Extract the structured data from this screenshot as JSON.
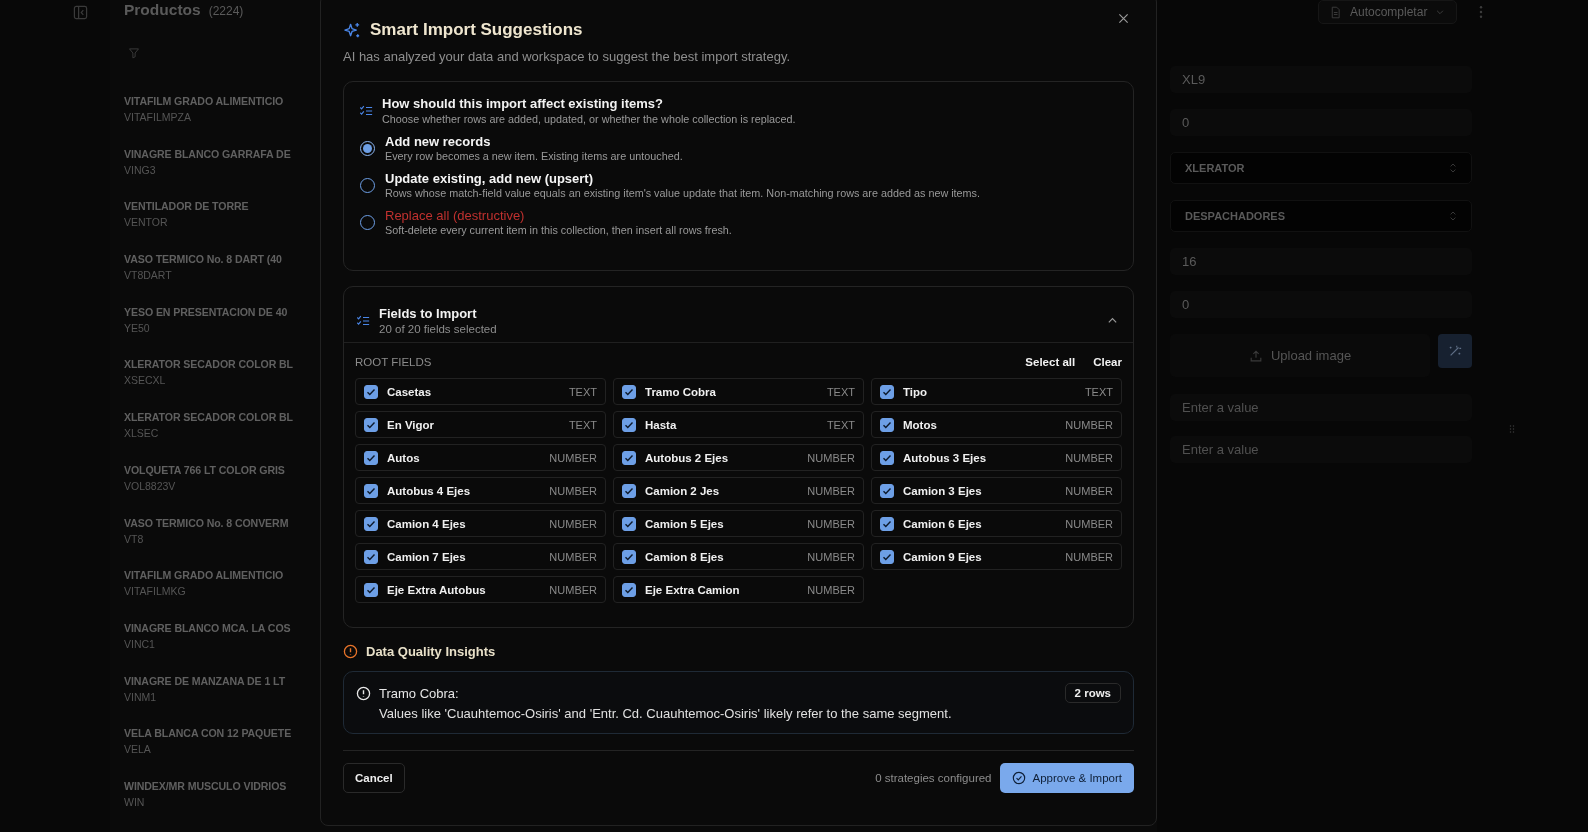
{
  "list": {
    "title": "Productos",
    "count": "(2224)",
    "items": [
      {
        "name": "VITAFILM GRADO ALIMENTICIO",
        "code": "VITAFILMPZA"
      },
      {
        "name": "VINAGRE BLANCO GARRAFA DE",
        "code": "VING3"
      },
      {
        "name": "VENTILADOR DE TORRE",
        "code": "VENTOR"
      },
      {
        "name": "VASO TERMICO No. 8 DART (40",
        "code": "VT8DART"
      },
      {
        "name": "YESO EN PRESENTACION DE 40",
        "code": "YE50"
      },
      {
        "name": "XLERATOR SECADOR COLOR BL",
        "code": "XSECXL"
      },
      {
        "name": "XLERATOR SECADOR COLOR BL",
        "code": "XLSEC"
      },
      {
        "name": "VOLQUETA 766 LT COLOR GRIS",
        "code": "VOL8823V"
      },
      {
        "name": "VASO TERMICO No. 8 CONVERM",
        "code": "VT8"
      },
      {
        "name": "VITAFILM GRADO ALIMENTICIO",
        "code": "VITAFILMKG"
      },
      {
        "name": "VINAGRE BLANCO MCA. LA COS",
        "code": "VINC1"
      },
      {
        "name": "VINAGRE DE MANZANA DE 1 LT",
        "code": "VINM1"
      },
      {
        "name": "VELA BLANCA CON 12 PAQUETE",
        "code": "VELA"
      },
      {
        "name": "WINDEX/MR MUSCULO VIDRIOS",
        "code": "WIN"
      }
    ]
  },
  "toolbar": {
    "autocomplete": "Autocompletar"
  },
  "form": {
    "fields": [
      {
        "kind": "input",
        "value": "XL9"
      },
      {
        "kind": "input",
        "value": "0"
      },
      {
        "kind": "select",
        "value": "XLERATOR"
      },
      {
        "kind": "select",
        "value": "DESPACHADORES"
      },
      {
        "kind": "input",
        "value": "16"
      },
      {
        "kind": "input",
        "value": "0"
      },
      {
        "kind": "upload",
        "label": "Upload image"
      },
      {
        "kind": "input",
        "placeholder": "Enter a value"
      },
      {
        "kind": "input",
        "placeholder": "Enter a value"
      }
    ]
  },
  "dialog": {
    "title": "Smart Import Suggestions",
    "subtitle": "AI has analyzed your data and workspace to suggest the best import strategy.",
    "mode": {
      "title": "How should this import affect existing items?",
      "hint": "Choose whether rows are added, updated, or whether the whole collection is replaced.",
      "options": [
        {
          "label": "Add new records",
          "description": "Every row becomes a new item. Existing items are untouched.",
          "selected": true,
          "kind": "normal"
        },
        {
          "label": "Update existing, add new (upsert)",
          "description": "Rows whose match-field value equals an existing item's value update that item. Non-matching rows are added as new items.",
          "selected": false,
          "kind": "normal"
        },
        {
          "label": "Replace all (destructive)",
          "description": "Soft-delete every current item in this collection, then insert all rows fresh.",
          "selected": false,
          "kind": "destructive"
        }
      ]
    },
    "fields": {
      "title": "Fields to Import",
      "count": "20 of 20 fields selected",
      "expanded": true,
      "group": "ROOT FIELDS",
      "select_all": "Select all",
      "clear": "Clear",
      "items": [
        {
          "name": "Casetas",
          "type": "TEXT",
          "checked": true
        },
        {
          "name": "Tramo Cobra",
          "type": "TEXT",
          "checked": true
        },
        {
          "name": "Tipo",
          "type": "TEXT",
          "checked": true
        },
        {
          "name": "En Vigor",
          "type": "TEXT",
          "checked": true
        },
        {
          "name": "Hasta",
          "type": "TEXT",
          "checked": true
        },
        {
          "name": "Motos",
          "type": "NUMBER",
          "checked": true
        },
        {
          "name": "Autos",
          "type": "NUMBER",
          "checked": true
        },
        {
          "name": "Autobus 2 Ejes",
          "type": "NUMBER",
          "checked": true
        },
        {
          "name": "Autobus 3 Ejes",
          "type": "NUMBER",
          "checked": true
        },
        {
          "name": "Autobus 4 Ejes",
          "type": "NUMBER",
          "checked": true
        },
        {
          "name": "Camion 2 Jes",
          "type": "NUMBER",
          "checked": true
        },
        {
          "name": "Camion 3 Ejes",
          "type": "NUMBER",
          "checked": true
        },
        {
          "name": "Camion 4 Ejes",
          "type": "NUMBER",
          "checked": true
        },
        {
          "name": "Camion 5 Ejes",
          "type": "NUMBER",
          "checked": true
        },
        {
          "name": "Camion 6 Ejes",
          "type": "NUMBER",
          "checked": true
        },
        {
          "name": "Camion 7 Ejes",
          "type": "NUMBER",
          "checked": true
        },
        {
          "name": "Camion 8 Ejes",
          "type": "NUMBER",
          "checked": true
        },
        {
          "name": "Camion 9 Ejes",
          "type": "NUMBER",
          "checked": true
        },
        {
          "name": "Eje Extra Autobus",
          "type": "NUMBER",
          "checked": true
        },
        {
          "name": "Eje Extra Camion",
          "type": "NUMBER",
          "checked": true
        }
      ]
    },
    "insights": {
      "title": "Data Quality Insights",
      "items": [
        {
          "field": "Tramo Cobra:",
          "message": "Values like 'Cuauhtemoc-Osiris' and 'Entr. Cd. Cuauhtemoc-Osiris' likely refer to the same segment.",
          "badge": "2 rows"
        }
      ]
    },
    "footer": {
      "cancel": "Cancel",
      "status": "0 strategies configured",
      "approve": "Approve & Import"
    }
  }
}
